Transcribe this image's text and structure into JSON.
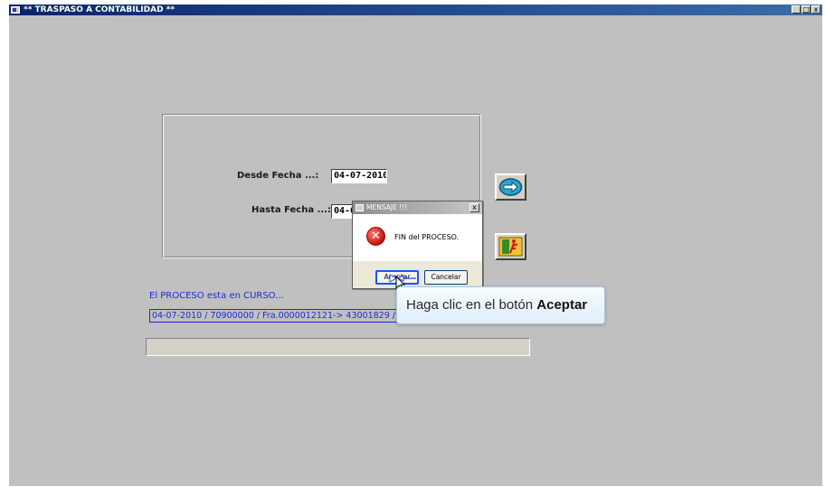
{
  "window": {
    "title": "** TRASPASO A CONTABILIDAD **",
    "controls": {
      "minimize": "_",
      "maximize": "□",
      "close": "x"
    }
  },
  "form": {
    "desde_label": "Desde Fecha ...:",
    "desde_value": "04-07-2010",
    "hasta_label": "Hasta Fecha ...:",
    "hasta_value": "04-0"
  },
  "buttons": {
    "process_icon": "arrow-right-icon",
    "exit_icon": "exit-door-icon"
  },
  "status": {
    "label": "El PROCESO esta en CURSO...",
    "log_line": "04-07-2010 / 70900000 / Fra.0000012121-> 43001829  / BIV"
  },
  "dialog": {
    "title": "MENSAJE !!!",
    "close": "x",
    "message": "FIN del PROCESO.",
    "accept_label": "Aceptar",
    "cancel_label": "Cancelar",
    "icon": "error-icon"
  },
  "tooltip": {
    "text_prefix": "Haga clic en el botón ",
    "text_bold": "Aceptar"
  },
  "colors": {
    "window_bg": "#c0c0c0",
    "titlebar": "#0a246a",
    "status_text": "#1a2bd8",
    "dialog_bg": "#ece9d8",
    "tooltip_bg": "#e1eefb",
    "error_red": "#c3140c",
    "highlight_blue": "#1a53ff"
  }
}
